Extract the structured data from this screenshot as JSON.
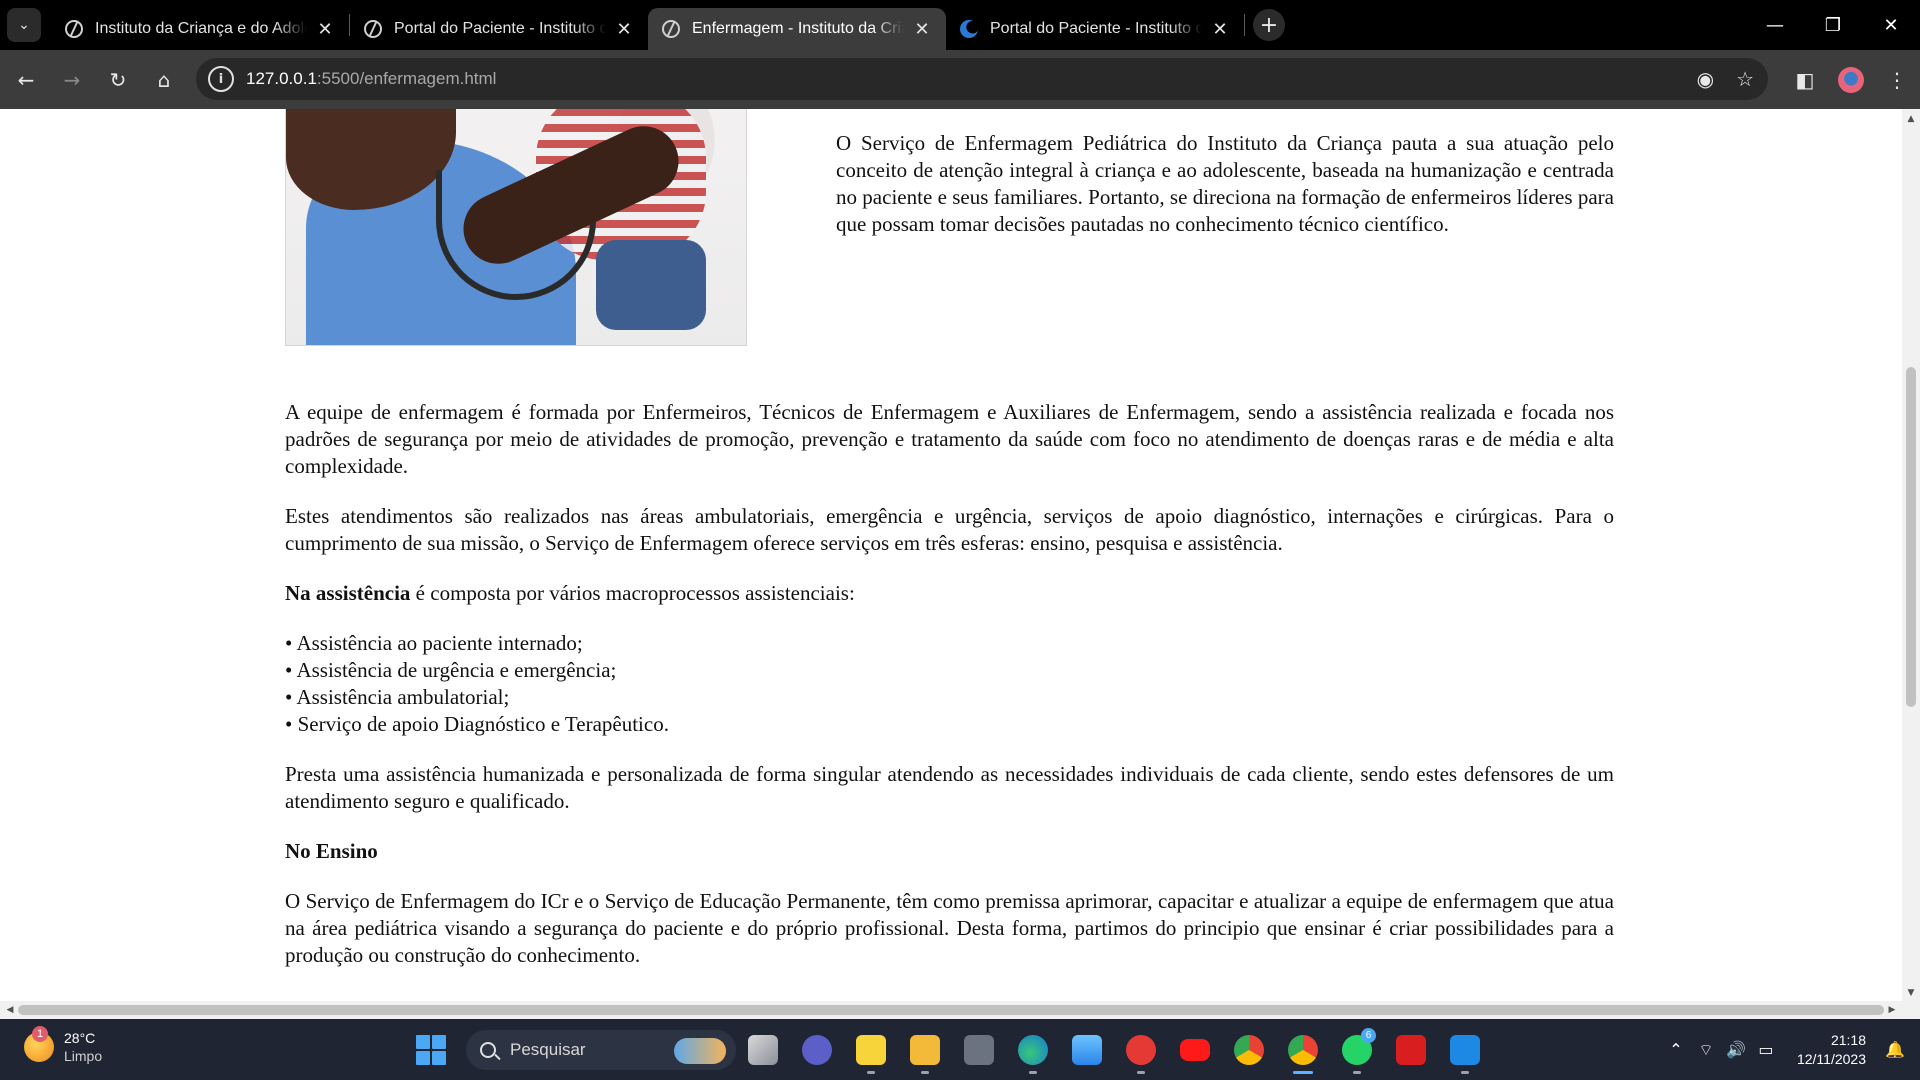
{
  "browser": {
    "tabs": [
      {
        "title": "Instituto da Criança e do Adolescente",
        "favicon": "globe-icon",
        "active": false
      },
      {
        "title": "Portal do Paciente - Instituto da Criança",
        "favicon": "globe-icon",
        "active": false
      },
      {
        "title": "Enfermagem - Instituto da Criança",
        "favicon": "globe-icon",
        "active": true
      },
      {
        "title": "Portal do Paciente - Instituto da Criança",
        "favicon": "crescent-icon",
        "active": false
      }
    ],
    "tab_close_glyph": "✕",
    "new_tab_glyph": "+",
    "url_host": "127.0.0.1",
    "url_path": ":5500/enfermagem.html"
  },
  "page": {
    "intro": "O Serviço de Enfermagem Pediátrica do Instituto da Criança pauta a sua atuação pelo conceito de atenção integral à criança e ao adolescente, baseada na humanização e centrada no paciente e seus familiares. Portanto, se direciona na formação de enfermeiros líderes para que possam tomar decisões pautadas no conhecimento técnico científico.",
    "p1": "A equipe de enfermagem é formada por Enfermeiros, Técnicos de Enfermagem e Auxiliares de Enfermagem, sendo a assistência realizada e focada nos padrões de segurança por meio de atividades de promoção, prevenção e tratamento da saúde com foco no atendimento de doenças raras e de média e alta complexidade.",
    "p2": "Estes atendimentos são realizados nas áreas ambulatoriais, emergência e urgência, serviços de apoio diagnóstico, internações e cirúrgicas. Para o cumprimento de sua missão, o Serviço de Enfermagem oferece serviços em três esferas: ensino, pesquisa e assistência.",
    "assist_heading": "Na assistência",
    "assist_text": " é composta por vários macroprocessos assistenciais:",
    "list": [
      "• Assistência ao paciente internado;",
      "• Assistência de urgência e emergência;",
      "• Assistência ambulatorial;",
      "• Serviço de apoio Diagnóstico e Terapêutico."
    ],
    "p3": "Presta uma assistência humanizada e personalizada de forma singular atendendo as necessidades individuais de cada cliente, sendo estes defensores de um atendimento seguro e qualificado.",
    "ensino_heading": "No Ensino",
    "p4": "O Serviço de Enfermagem do ICr e o Serviço de Educação Permanente, têm como premissa aprimorar, capacitar e atualizar a equipe de enfermagem que atua na área pediátrica visando a segurança do paciente e do próprio profissional. Desta forma, partimos do principio que ensinar é criar possibilidades para a produção ou construção do conhecimento."
  },
  "taskbar": {
    "weather_temp": "28°C",
    "weather_desc": "Limpo",
    "weather_badge": "1",
    "search_placeholder": "Pesquisar",
    "whatsapp_badge": "6",
    "time": "21:18",
    "date": "12/11/2023",
    "apps": [
      "file-explorer-icon",
      "teams-icon",
      "sticky-notes-icon",
      "folder-icon",
      "calculator-icon",
      "edge-icon",
      "icloud-icon",
      "youtube-music-icon",
      "youtube-icon",
      "chrome-icon",
      "chrome-profile-icon",
      "whatsapp-icon",
      "acrobat-icon",
      "vscode-icon"
    ]
  }
}
